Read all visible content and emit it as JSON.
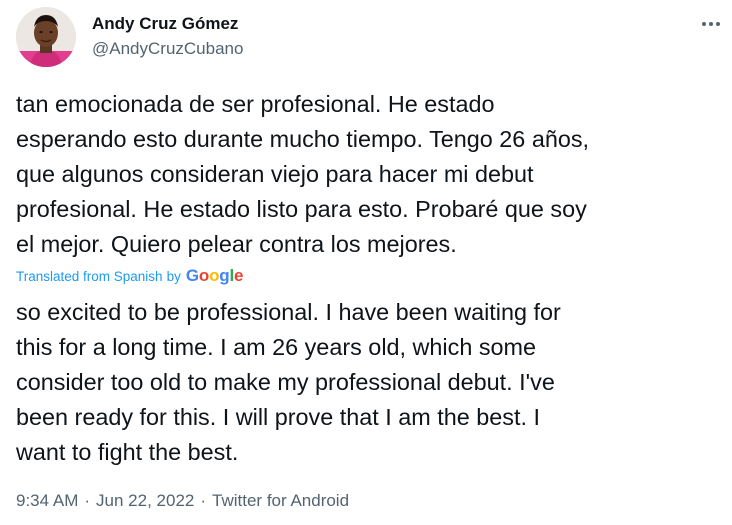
{
  "author": {
    "display_name": "Andy Cruz Gómez",
    "handle": "@AndyCruzCubano"
  },
  "menu": {
    "icon": "more-horizontal-icon"
  },
  "tweet": {
    "original_text": "tan emocionada de ser profesional. He estado\nesperando esto durante mucho tiempo. Tengo 26 años,\nque algunos consideran viejo para hacer mi debut\nprofesional. He estado listo para esto. Probaré que soy\nel mejor. Quiero pelear contra los mejores.",
    "translation_label": "Translated from Spanish",
    "translation_by": "by",
    "translation_provider": "Google",
    "translated_text": "so excited to be professional. I have been waiting for\nthis for a long time. I am 26 years old, which some\nconsider too old to make my professional debut. I've\nbeen ready for this. I will prove that I am the best. I\nwant to fight the best."
  },
  "meta": {
    "time": "9:34 AM",
    "separator": "·",
    "date": "Jun 22, 2022",
    "source": "Twitter for Android"
  },
  "colors": {
    "text": "#0f1419",
    "secondary": "#536471",
    "link": "#1d9bf0",
    "google_blue": "#4285F4",
    "google_red": "#EA4335",
    "google_yellow": "#FBBC05",
    "google_green": "#34A853"
  }
}
